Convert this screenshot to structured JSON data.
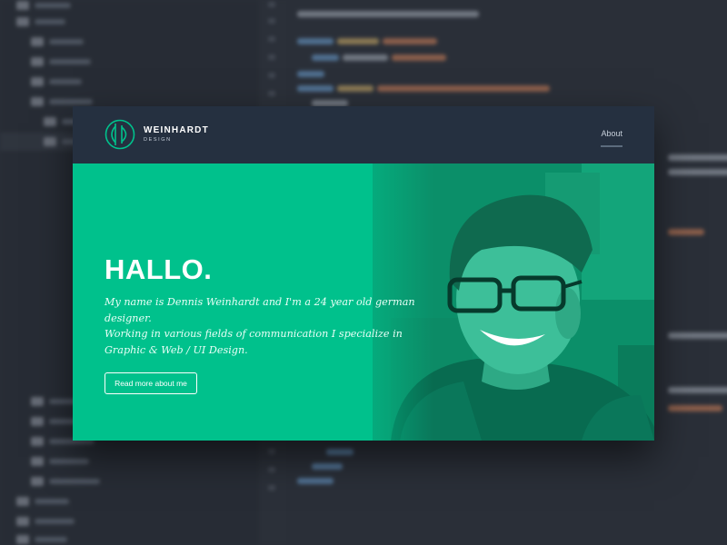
{
  "site": {
    "brand_name": "WEINHARDT",
    "brand_sub": "DESIGN",
    "nav": {
      "about_label": "About"
    }
  },
  "hero": {
    "title": "HALLO.",
    "line1": "My name is Dennis Weinhardt and I'm a 24 year old german designer.",
    "line2": "Working in various fields of communication I specialize in Graphic & Web / UI Design.",
    "button_label": "Read more about me"
  },
  "colors": {
    "header_bg": "#253040",
    "hero_green": "#00c18c",
    "backdrop": "#2a2f38"
  },
  "icons": {
    "logo": "weinhardt-logo-mark-icon"
  }
}
